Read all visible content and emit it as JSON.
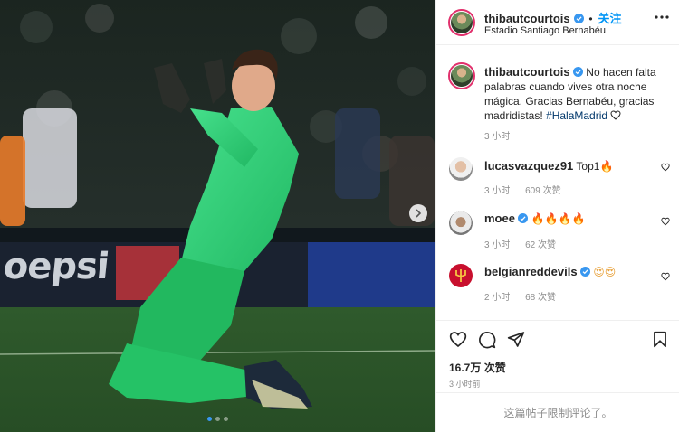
{
  "post": {
    "author": "thibautcourtois",
    "follow_label": "关注",
    "separator": "•",
    "location": "Estadio Santiago Bernabéu",
    "caption_lines": [
      "No hacen falta",
      "palabras cuando vives otra noche",
      "mágica. Gracias Bernabéu, gracias",
      "madridistas!"
    ],
    "caption_hashtag": "#HalaMadrid",
    "caption_time": "3 小时",
    "likes": "16.7万 次赞",
    "posted_ago": "3 小时前",
    "comments_limited": "这篇帖子限制评论了。"
  },
  "media": {
    "hoarding_text": "oepsi",
    "slide_count": 3,
    "active_slide": 0
  },
  "comments": [
    {
      "user": "lucasvazquez91",
      "verified": false,
      "text": "Top1",
      "emoji": "🔥",
      "time": "3 小时",
      "likes": "609 次赞"
    },
    {
      "user": "moee",
      "verified": true,
      "text": "",
      "emoji": "🔥🔥🔥🔥",
      "time": "3 小时",
      "likes": "62 次赞"
    },
    {
      "user": "belgianreddevils",
      "verified": true,
      "text": "",
      "emoji": "😍😍",
      "time": "2 小时",
      "likes": "68 次赞"
    }
  ],
  "icons": {
    "verified": "verified-badge-icon",
    "more": "more-options-icon",
    "like": "heart-icon",
    "comment": "comment-icon",
    "share": "paper-plane-icon",
    "save": "bookmark-icon",
    "next": "chevron-right-icon"
  },
  "colors": {
    "verified_blue": "#3897f0",
    "follow_blue": "#0095f6",
    "hashtag": "#00376b",
    "muted": "#8e8e8e",
    "kit_green": "#2fd37a"
  }
}
